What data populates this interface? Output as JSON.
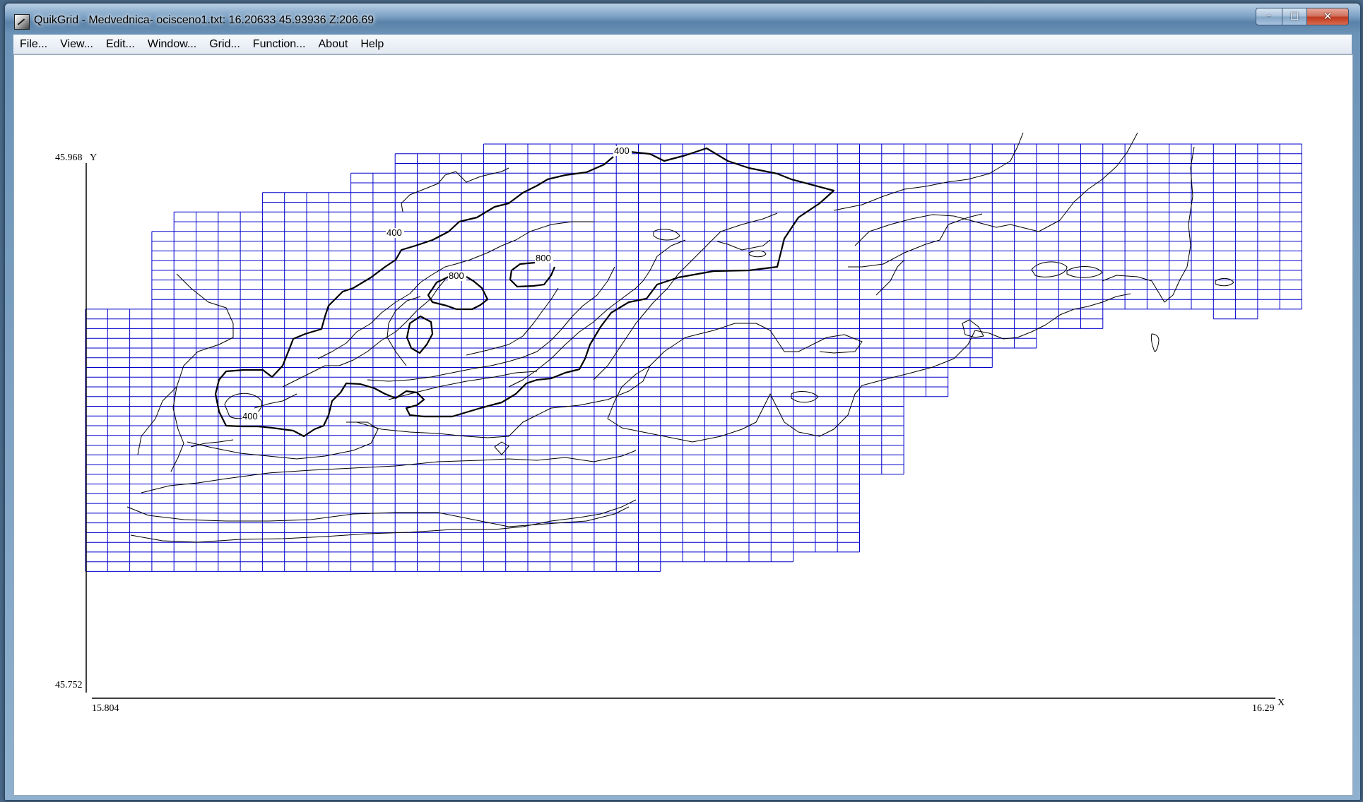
{
  "window": {
    "title": "QuikGrid - Medvednica- ocisceno1.txt: 16.20633 45.93936 Z:206.69",
    "buttons": {
      "minimize": "–",
      "maximize": "□",
      "close": "✕"
    }
  },
  "menu": {
    "items": [
      "File...",
      "View...",
      "Edit...",
      "Window...",
      "Grid...",
      "Function...",
      "About",
      "Help"
    ]
  },
  "plot": {
    "y_max_label": "45.968",
    "y_axis_name": "Y",
    "y_min_label": "45.752",
    "x_min_label": "15.804",
    "x_max_label": "16.29",
    "x_axis_name": "X",
    "grid_color": "#0000cc",
    "contour_color": "#000000",
    "contour_labels": [
      "400",
      "400",
      "800",
      "800",
      "400"
    ]
  }
}
